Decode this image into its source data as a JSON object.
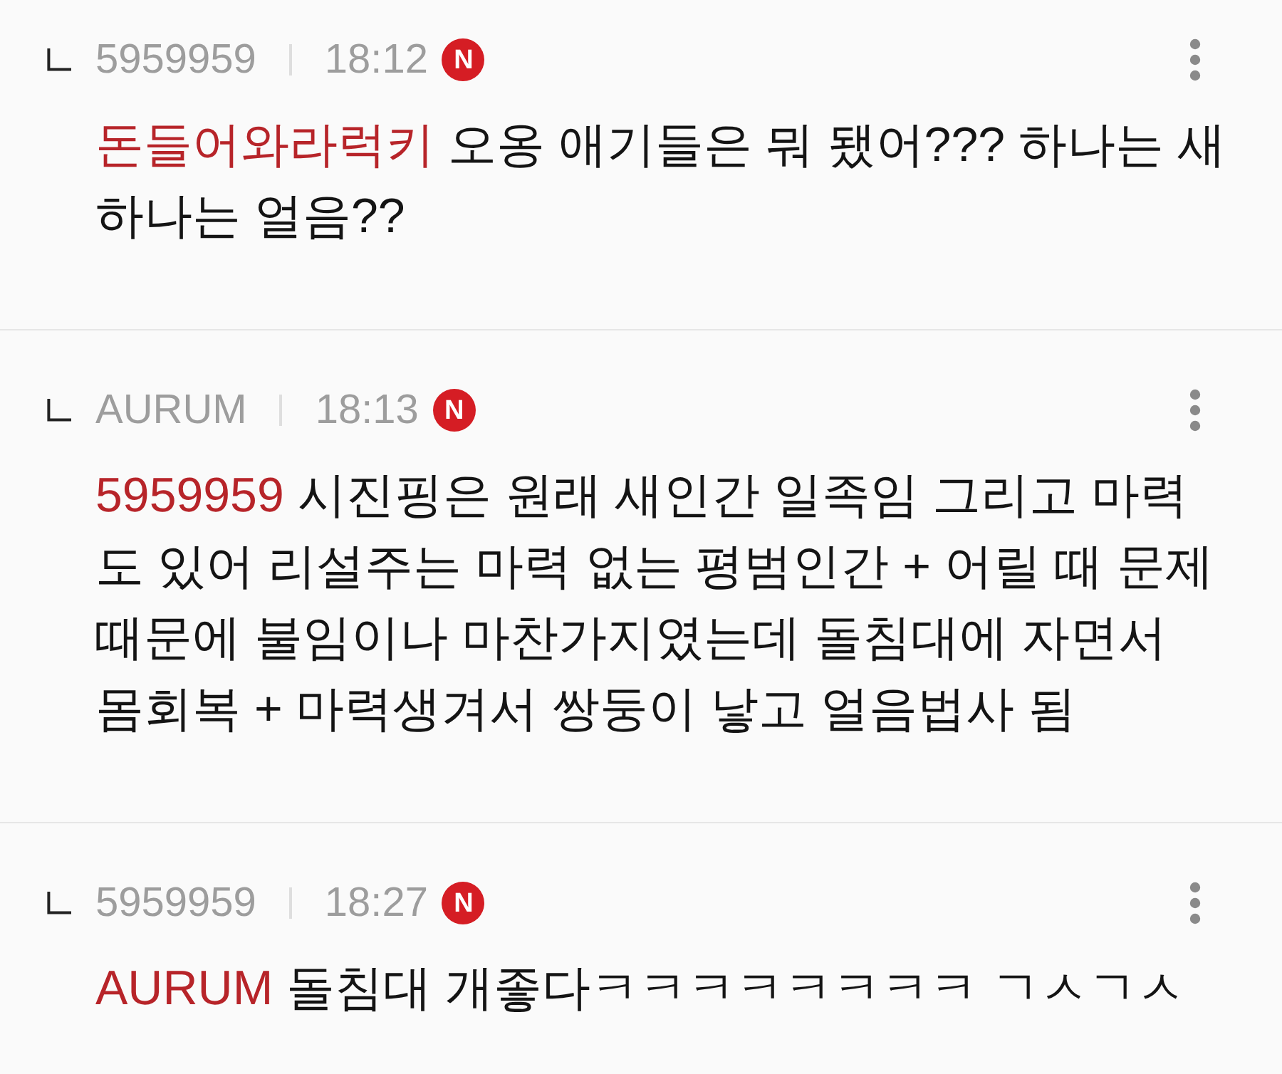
{
  "comments": [
    {
      "author": "5959959",
      "time": "18:12",
      "badge": "N",
      "mention": "돈들어와라럭키",
      "text": "오옹 애기들은 뭐 됐어??? 하나는 새 하나는 얼음??"
    },
    {
      "author": "AURUM",
      "time": "18:13",
      "badge": "N",
      "mention": "5959959",
      "text": "시진핑은 원래 새인간 일족임 그리고 마력도 있어 리설주는 마력 없는 평범인간 + 어릴 때 문제때문에 불임이나 마찬가지였는데 돌침대에 자면서 몸회복 + 마력생겨서 쌍둥이 낳고 얼음법사 됨"
    },
    {
      "author": "5959959",
      "time": "18:27",
      "badge": "N",
      "mention": "AURUM",
      "text": "돌침대 개좋다ㅋㅋㅋㅋㅋㅋㅋㅋ ㄱㅅㄱㅅ"
    }
  ]
}
